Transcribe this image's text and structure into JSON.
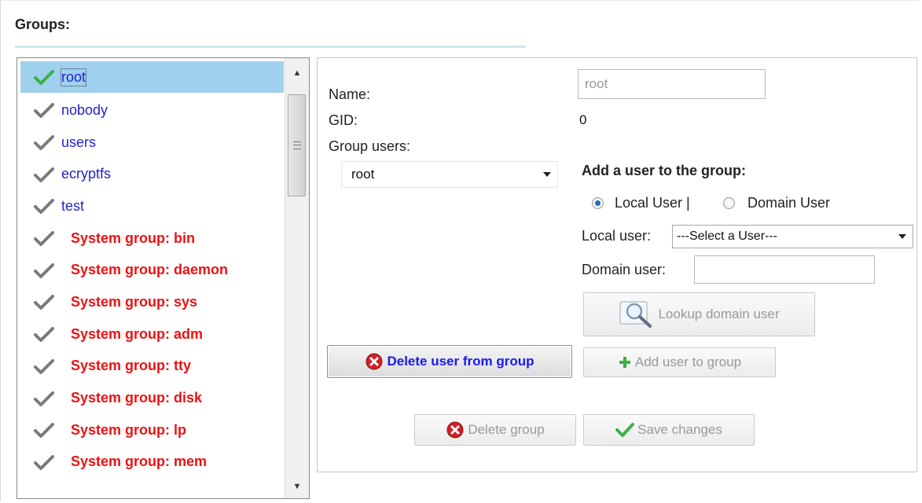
{
  "section_title": "Groups:",
  "groups": [
    {
      "name": "root",
      "kind": "user",
      "selected": true
    },
    {
      "name": "nobody",
      "kind": "user"
    },
    {
      "name": "users",
      "kind": "user"
    },
    {
      "name": "ecryptfs",
      "kind": "user"
    },
    {
      "name": "test",
      "kind": "user"
    },
    {
      "name": "System group: bin",
      "kind": "system"
    },
    {
      "name": "System group: daemon",
      "kind": "system"
    },
    {
      "name": "System group: sys",
      "kind": "system"
    },
    {
      "name": "System group: adm",
      "kind": "system"
    },
    {
      "name": "System group: tty",
      "kind": "system"
    },
    {
      "name": "System group: disk",
      "kind": "system"
    },
    {
      "name": "System group: lp",
      "kind": "system"
    },
    {
      "name": "System group: mem",
      "kind": "system"
    }
  ],
  "details": {
    "name_label": "Name:",
    "name_value": "root",
    "gid_label": "GID:",
    "gid_value": "0",
    "group_users_label": "Group users:",
    "group_users_selected": "root"
  },
  "add_user": {
    "heading": "Add a user to the group:",
    "local_radio_label": "Local User |",
    "domain_radio_label": "Domain User",
    "local_user_label": "Local user:",
    "local_user_selected": "---Select a User---",
    "domain_user_label": "Domain user:",
    "domain_user_value": "",
    "lookup_button": "Lookup domain user"
  },
  "buttons": {
    "delete_user": "Delete user from group",
    "add_user": "Add user to group",
    "delete_group": "Delete group",
    "save_changes": "Save changes"
  },
  "colors": {
    "user_group_text": "#2222d0",
    "system_group_text": "#ee1111",
    "selection_bg": "#9fd0ee",
    "check_gray": "#7a7a7a",
    "check_green": "#3cb043",
    "delete_red": "#d0202a"
  }
}
